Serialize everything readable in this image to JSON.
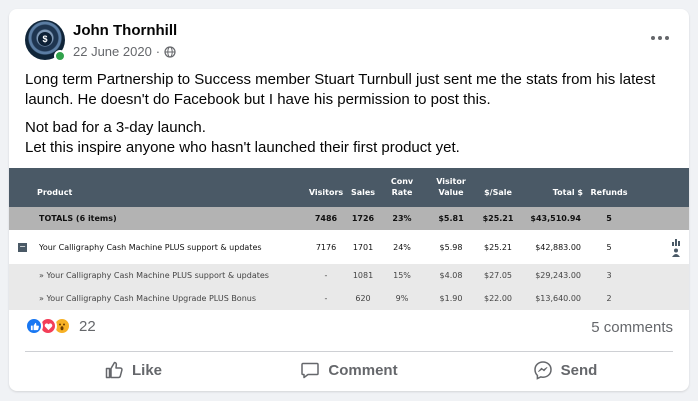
{
  "post": {
    "author": "John Thornhill",
    "date": "22 June 2020",
    "audience_icon": "globe-icon",
    "more_icon": "more-options-icon",
    "text": [
      "Long term Partnership to Success member Stuart Turnbull just sent me the stats from his latest launch. He doesn't do Facebook but I have his permission to post this.",
      "Not bad for a 3-day launch.",
      "Let this inspire anyone who hasn't launched their first product yet."
    ]
  },
  "table": {
    "headers": {
      "product": "Product",
      "visitors": "Visitors",
      "sales": "Sales",
      "conv_rate_1": "Conv",
      "conv_rate_2": "Rate",
      "visitor_value_1": "Visitor",
      "visitor_value_2": "Value",
      "per_sale": "$/Sale",
      "total": "Total $",
      "refunds": "Refunds"
    },
    "totals": {
      "product": "TOTALS (6 items)",
      "visitors": "7486",
      "sales": "1726",
      "conv_rate": "23%",
      "visitor_value": "$5.81",
      "per_sale": "$25.21",
      "total": "$43,510.94",
      "refunds": "5"
    },
    "main_row": {
      "product": "Your Calligraphy Cash Machine PLUS support & updates",
      "visitors": "7176",
      "sales": "1701",
      "conv_rate": "24%",
      "visitor_value": "$5.98",
      "per_sale": "$25.21",
      "total": "$42,883.00",
      "refunds": "5"
    },
    "sub_rows": [
      {
        "product": "» Your Calligraphy Cash Machine PLUS support & updates",
        "visitors": "-",
        "sales": "1081",
        "conv_rate": "15%",
        "visitor_value": "$4.08",
        "per_sale": "$27.05",
        "total": "$29,243.00",
        "refunds": "3"
      },
      {
        "product": "» Your Calligraphy Cash Machine Upgrade PLUS Bonus",
        "visitors": "-",
        "sales": "620",
        "conv_rate": "9%",
        "visitor_value": "$1.90",
        "per_sale": "$22.00",
        "total": "$13,640.00",
        "refunds": "2"
      }
    ]
  },
  "engagement": {
    "reaction_count": "22",
    "comments": "5 comments"
  },
  "actions": {
    "like": "Like",
    "comment": "Comment",
    "send": "Send"
  },
  "colors": {
    "online": "#31a24c",
    "like_blue": "#1877f2",
    "love_red": "#f33e58",
    "wow_yellow": "#f7b125",
    "table_header": "#4a5966"
  }
}
